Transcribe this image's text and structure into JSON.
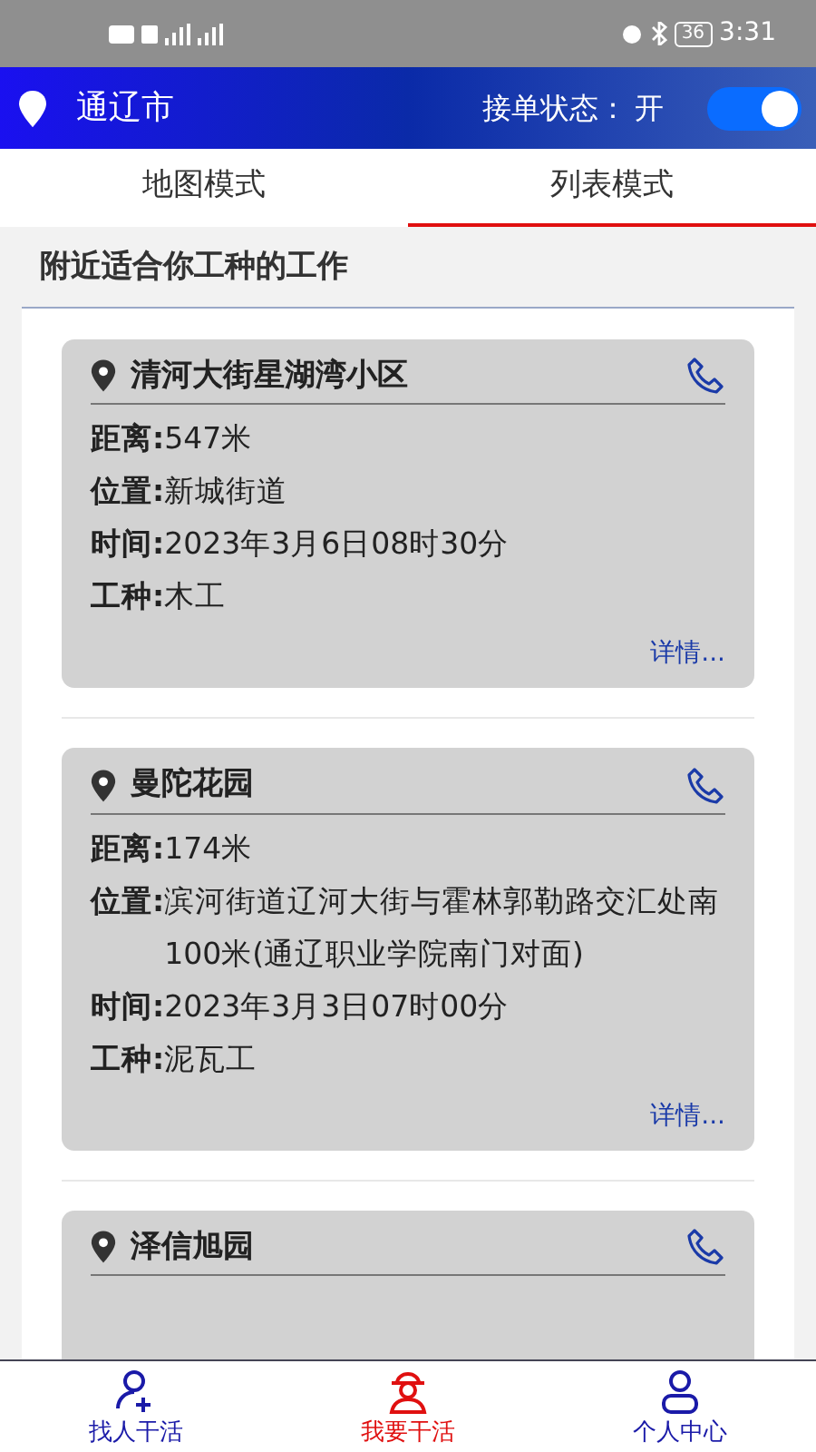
{
  "status_bar": {
    "battery": "36",
    "time": "3:31"
  },
  "header": {
    "city": "通辽市",
    "order_status_label": "接单状态：",
    "order_status_value": "开",
    "order_toggle_on": true
  },
  "tabs": [
    {
      "label": "地图模式",
      "selected": false
    },
    {
      "label": "列表模式",
      "selected": true
    }
  ],
  "section_title": "附近适合你工种的工作",
  "jobs": [
    {
      "title": "清河大街星湖湾小区",
      "fields": [
        {
          "label": "距离:",
          "value": "547米"
        },
        {
          "label": "位置:",
          "value": "新城街道"
        },
        {
          "label": "时间:",
          "value": "2023年3月6日08时30分"
        },
        {
          "label": "工种:",
          "value": "木工"
        }
      ],
      "details_link": "详情..."
    },
    {
      "title": "曼陀花园",
      "fields": [
        {
          "label": "距离:",
          "value": "174米"
        },
        {
          "label": "位置:",
          "value": "滨河街道辽河大街与霍林郭勒路交汇处南100米(通辽职业学院南门对面)"
        },
        {
          "label": "时间:",
          "value": "2023年3月3日07时00分"
        },
        {
          "label": "工种:",
          "value": "泥瓦工"
        }
      ],
      "details_link": "详情..."
    },
    {
      "title": "泽信旭园"
    }
  ],
  "bottom_nav": [
    {
      "label": "找人干活",
      "kind": "find-worker",
      "selected": false
    },
    {
      "label": "我要干活",
      "kind": "find-work",
      "selected": true
    },
    {
      "label": "个人中心",
      "kind": "profile",
      "selected": false
    }
  ]
}
